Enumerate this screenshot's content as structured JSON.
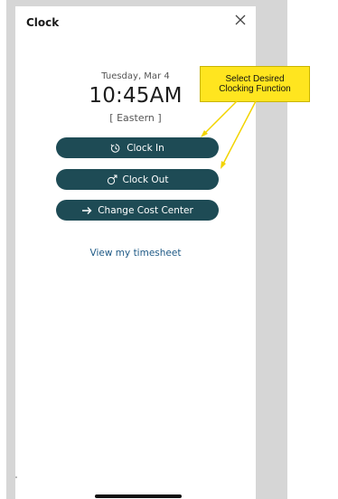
{
  "header": {
    "title": "Clock"
  },
  "clock": {
    "date": "Tuesday, Mar 4",
    "time": "10:45AM",
    "timezone": "[ Eastern ]"
  },
  "actions": {
    "clock_in": "Clock In",
    "clock_out": "Clock Out",
    "change_cost_center": "Change Cost Center"
  },
  "links": {
    "view_timesheet": "View my timesheet"
  },
  "annotation": {
    "line1": "Select Desired",
    "line2": "Clocking Function"
  },
  "colors": {
    "button_bg": "#1e4b55",
    "link": "#1f5a86",
    "callout_bg": "#ffe51f"
  },
  "icons": {
    "close": "close-icon",
    "clock_in": "clock-in-icon",
    "clock_out": "clock-out-icon",
    "change_cost_center": "arrow-right-icon"
  }
}
